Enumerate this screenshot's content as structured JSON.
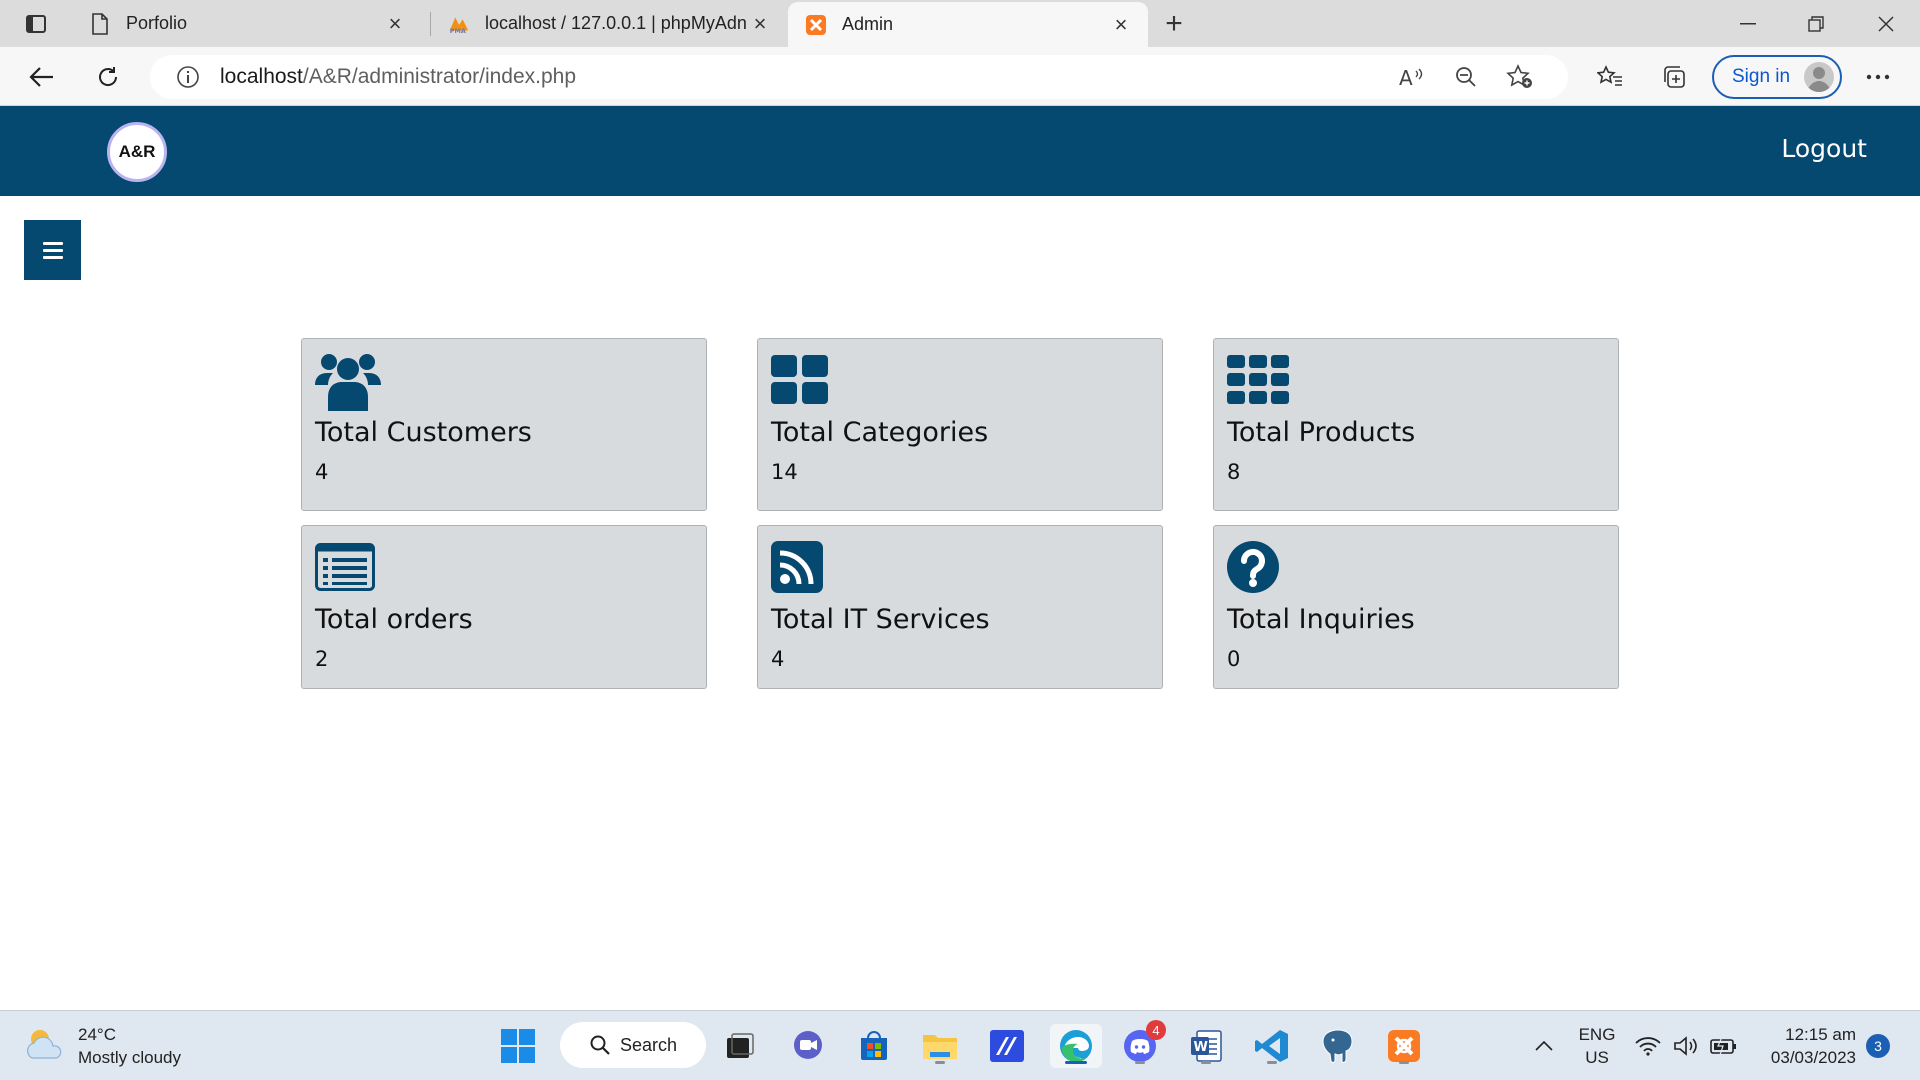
{
  "browser": {
    "tabs": [
      {
        "title": "Porfolio",
        "icon": "page-icon"
      },
      {
        "title": "localhost / 127.0.0.1 | phpMyAdn",
        "icon": "phpmyadmin-icon"
      },
      {
        "title": "Admin",
        "icon": "xampp-icon"
      }
    ],
    "url_host": "localhost",
    "url_path": "/A&R/administrator/index.php",
    "signin_label": "Sign in"
  },
  "site": {
    "logo_text": "A&R",
    "logout_label": "Logout",
    "brand_color": "#054870"
  },
  "dashboard": {
    "cards": [
      {
        "title": "Total Customers",
        "value": "4",
        "icon": "users-icon"
      },
      {
        "title": "Total Categories",
        "value": "14",
        "icon": "grid-large-icon"
      },
      {
        "title": "Total Products",
        "value": "8",
        "icon": "grid-small-icon"
      },
      {
        "title": "Total orders",
        "value": "2",
        "icon": "list-icon"
      },
      {
        "title": "Total IT Services",
        "value": "4",
        "icon": "rss-icon"
      },
      {
        "title": "Total Inquiries",
        "value": "0",
        "icon": "question-icon"
      }
    ]
  },
  "taskbar": {
    "weather_temp": "24°C",
    "weather_desc": "Mostly cloudy",
    "search_label": "Search",
    "discord_badge": "4",
    "lang_line1": "ENG",
    "lang_line2": "US",
    "time": "12:15 am",
    "date": "03/03/2023",
    "notification_count": "3"
  }
}
